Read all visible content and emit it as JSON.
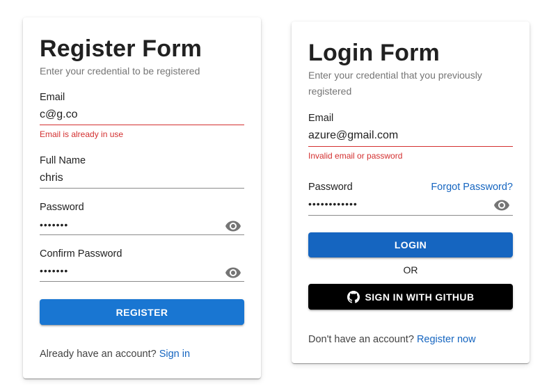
{
  "register": {
    "title": "Register Form",
    "subtitle": "Enter your credential to be registered",
    "email_label": "Email",
    "email_value": "c@g.co",
    "email_error": "Email is already in use",
    "fullname_label": "Full Name",
    "fullname_value": "chris",
    "password_label": "Password",
    "password_value": "•••••••",
    "confirm_label": "Confirm Password",
    "confirm_value": "•••••••",
    "submit_label": "REGISTER",
    "footer_text": "Already have an account?",
    "footer_link": "Sign in"
  },
  "login": {
    "title": "Login Form",
    "subtitle_line1": "Enter your credential that you previously",
    "subtitle_line2": "registered",
    "email_label": "Email",
    "email_value": "azure@gmail.com",
    "email_error": "Invalid email or password",
    "password_label": "Password",
    "forgot_link": "Forgot Password?",
    "password_value": "••••••••••••",
    "submit_label": "LOGIN",
    "or_text": "OR",
    "github_label": "SIGN IN WITH GITHUB",
    "footer_text": "Don't have an account?",
    "footer_link": "Register now"
  },
  "icons": {
    "password_toggle": "eye-icon",
    "github": "github-icon"
  },
  "colors": {
    "primary": "#1976d2",
    "primary_dark": "#1565c0",
    "error": "#d32f2f",
    "github_button": "#000000"
  }
}
